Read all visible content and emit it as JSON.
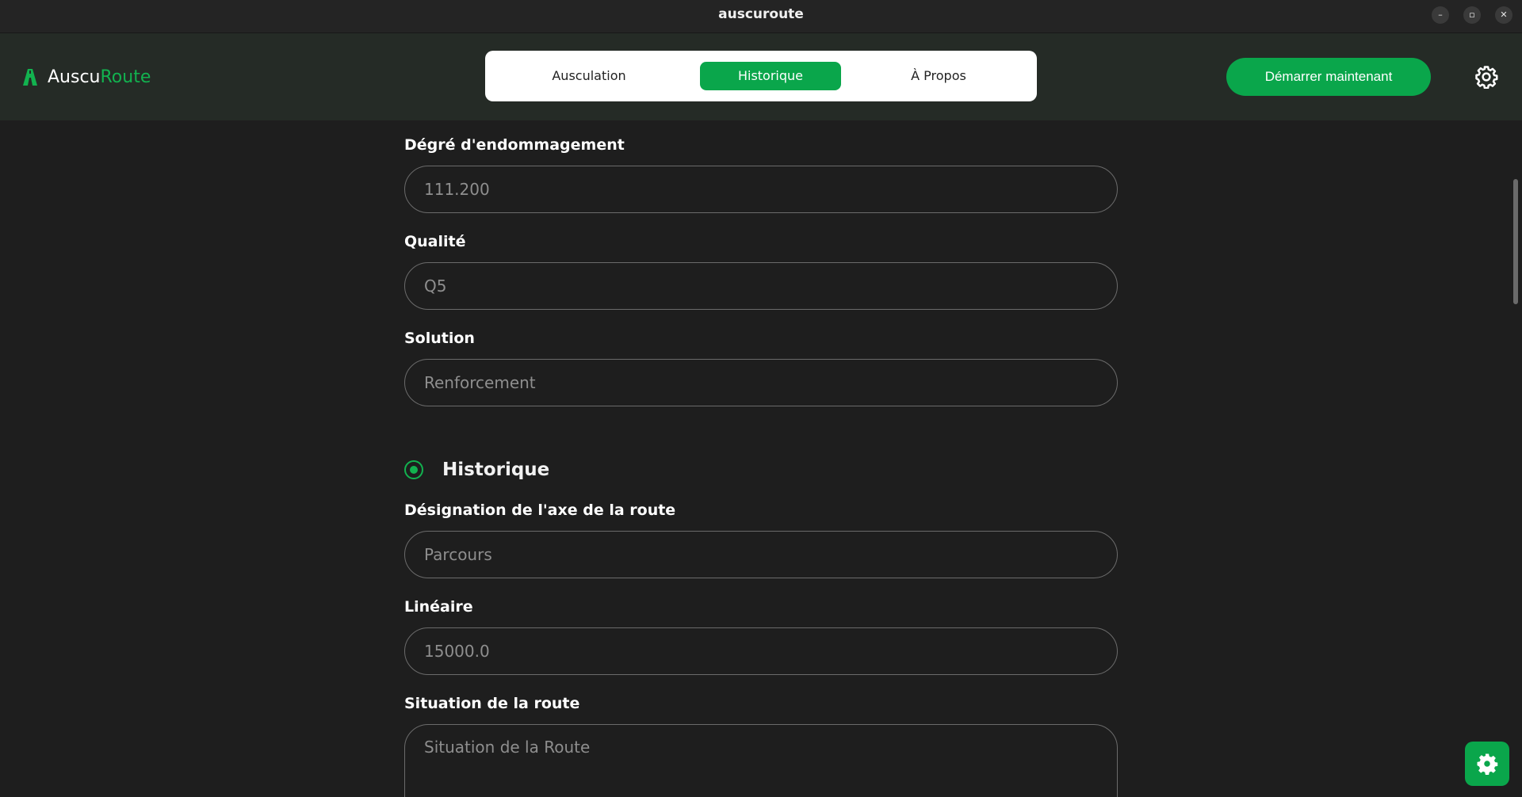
{
  "window": {
    "title": "auscuroute",
    "minimize_glyph": "–",
    "restore_glyph": "▫",
    "close_glyph": "✕"
  },
  "header": {
    "logo_part1": "Auscu",
    "logo_part2": "Route",
    "tabs": [
      {
        "label": "Ausculation",
        "active": false
      },
      {
        "label": "Historique",
        "active": true
      },
      {
        "label": "À Propos",
        "active": false
      }
    ],
    "cta_label": "Démarrer maintenant",
    "settings_icon": "gear-icon"
  },
  "form": {
    "degre": {
      "label": "Dégré d'endommagement",
      "value": "111.200"
    },
    "qualite": {
      "label": "Qualité",
      "value": "Q5"
    },
    "solution": {
      "label": "Solution",
      "value": "Renforcement"
    },
    "historique_section": {
      "title": "Historique"
    },
    "designation": {
      "label": "Désignation de l'axe de la route",
      "placeholder": "Parcours"
    },
    "lineaire": {
      "label": "Linéaire",
      "value": "15000.0"
    },
    "situation": {
      "label": "Situation de la route",
      "placeholder": "Situation de la Route"
    }
  },
  "colors": {
    "accent": "#0aa64b",
    "brand_green": "#12b24f",
    "background": "#1e1e1e",
    "header_bg": "#252b26"
  }
}
